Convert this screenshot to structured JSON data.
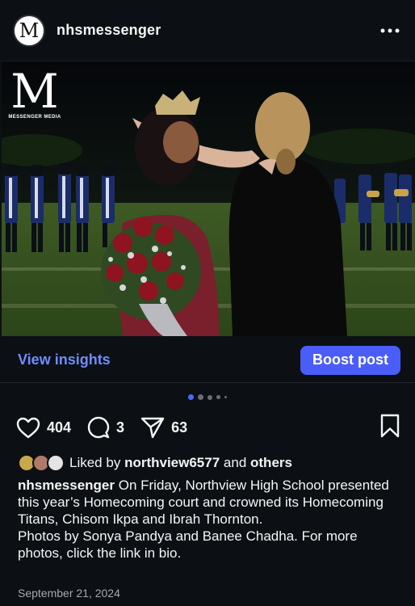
{
  "post": {
    "username": "nhsmessenger",
    "avatar_letter": "M",
    "watermark_letter": "M",
    "watermark_text": "MESSENGER MEDIA",
    "view_insights_label": "View insights",
    "boost_label": "Boost post",
    "carousel": {
      "count": 5,
      "active_index": 0
    },
    "likes_count": "404",
    "comments_count": "3",
    "shares_count": "63",
    "liked_by_prefix": "Liked by",
    "liked_by_user": "northview6577",
    "liked_by_and": "and",
    "liked_by_others": "others",
    "caption_user": "nhsmessenger",
    "caption_text": "On Friday, Northview High School presented this year’s Homecoming court and crowned its Homecoming Titans, Chisom Ikpa and Ibrah Thornton.",
    "caption_credit": "Photos by Sonya Pandya and Banee Chadha. For more photos, click the link in bio.",
    "date": "September 21, 2024"
  },
  "icons": [
    "more-options-icon",
    "heart-icon",
    "comment-icon",
    "share-icon",
    "bookmark-icon"
  ],
  "colors": {
    "background": "#0c1014",
    "link": "#708dff",
    "boost": "#4a5df9",
    "dot_active": "#4a6cff"
  }
}
